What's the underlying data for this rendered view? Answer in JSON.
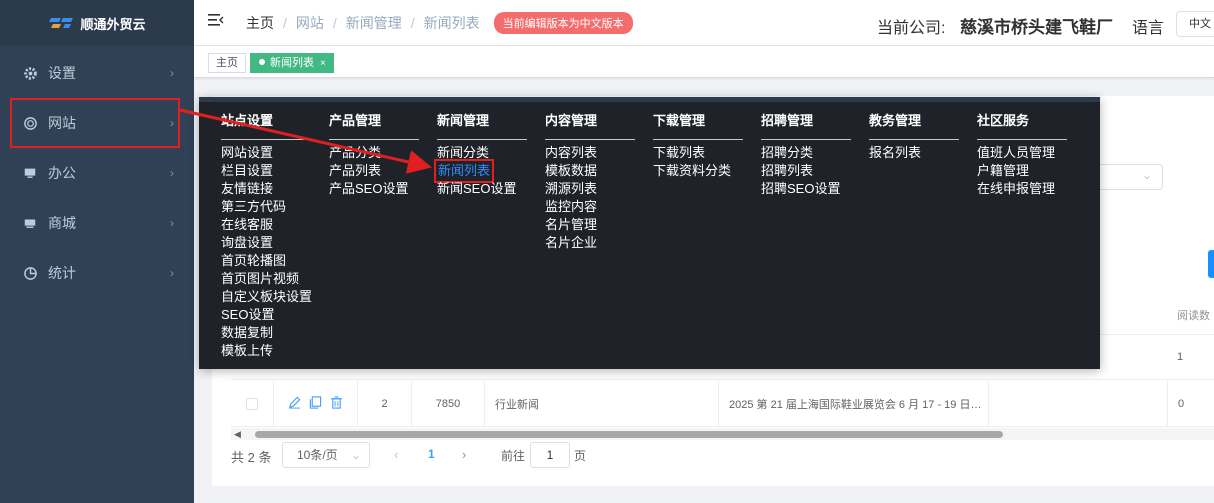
{
  "sidebar": {
    "logo": "顺通外贸云",
    "items": [
      {
        "label": "设置",
        "icon": "gear-icon"
      },
      {
        "label": "网站",
        "icon": "globe-icon",
        "highlighted": true
      },
      {
        "label": "办公",
        "icon": "monitor-icon"
      },
      {
        "label": "商城",
        "icon": "store-icon"
      },
      {
        "label": "统计",
        "icon": "pie-chart-icon"
      }
    ]
  },
  "topbar": {
    "breadcrumb": [
      "主页",
      "网站",
      "新闻管理",
      "新闻列表"
    ],
    "badge": "当前编辑版本为中文版本",
    "company_label": "当前公司:",
    "company_name": "慈溪市桥头建飞鞋厂",
    "language_label": "语言",
    "language_value": "中文"
  },
  "tags": {
    "home": "主页",
    "active": "新闻列表",
    "close": "×"
  },
  "mega_menu": {
    "columns": [
      {
        "title": "站点设置",
        "items": [
          "网站设置",
          "栏目设置",
          "友情链接",
          "第三方代码",
          "在线客服",
          "询盘设置",
          "首页轮播图",
          "首页图片视频",
          "自定义板块设置",
          "SEO设置",
          "数据复制",
          "模板上传"
        ]
      },
      {
        "title": "产品管理",
        "items": [
          "产品分类",
          "产品列表",
          "产品SEO设置"
        ]
      },
      {
        "title": "新闻管理",
        "items": [
          "新闻分类",
          "新闻列表",
          "新闻SEO设置"
        ],
        "selected": "新闻列表"
      },
      {
        "title": "内容管理",
        "items": [
          "内容列表",
          "模板数据",
          "溯源列表",
          "监控内容",
          "名片管理",
          "名片企业"
        ]
      },
      {
        "title": "下载管理",
        "items": [
          "下载列表",
          "下载资料分类"
        ]
      },
      {
        "title": "招聘管理",
        "items": [
          "招聘分类",
          "招聘列表",
          "招聘SEO设置"
        ]
      },
      {
        "title": "教务管理",
        "items": [
          "报名列表"
        ]
      },
      {
        "title": "社区服务",
        "items": [
          "值班人员管理",
          "户籍管理",
          "在线申报管理"
        ]
      }
    ]
  },
  "table": {
    "header_read": "阅读数",
    "row1_read": "1",
    "row2": {
      "index": "2",
      "id": "7850",
      "category": "行业新闻",
      "title": "2025 第 21 届上海国际鞋业展览会 6 月 17 - 19 日…",
      "read": "0"
    }
  },
  "pagination": {
    "total": "共 2 条",
    "page_size": "10条/页",
    "current": "1",
    "goto_label": "前往",
    "goto_value": "1",
    "page_suffix": "页"
  },
  "colors": {
    "sidebar_bg": "#304156",
    "mega_bg": "#1f2329",
    "accent": "#409eff",
    "badge": "#f56c6c",
    "tag_active": "#42b983",
    "annotation": "#e02020"
  }
}
